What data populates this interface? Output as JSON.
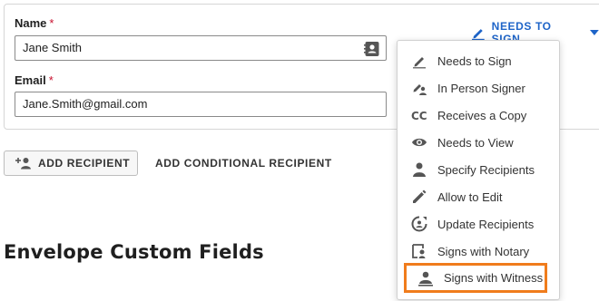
{
  "recipient": {
    "name_label": "Name",
    "name_required": "*",
    "name_value": "Jane Smith",
    "email_label": "Email",
    "email_required": "*",
    "email_value": "Jane.Smith@gmail.com",
    "role_trigger_label": "NEEDS TO SIGN"
  },
  "actions": {
    "add_recipient": "ADD RECIPIENT",
    "add_conditional_recipient": "ADD CONDITIONAL RECIPIENT"
  },
  "section": {
    "title": "Envelope Custom Fields"
  },
  "role_menu": {
    "items": [
      {
        "label": "Needs to Sign",
        "icon": "pen-icon"
      },
      {
        "label": "In Person Signer",
        "icon": "person-pen-icon"
      },
      {
        "label": "Receives a Copy",
        "icon": "cc-icon"
      },
      {
        "label": "Needs to View",
        "icon": "eye-icon"
      },
      {
        "label": "Specify Recipients",
        "icon": "person-icon"
      },
      {
        "label": "Allow to Edit",
        "icon": "pencil-icon"
      },
      {
        "label": "Update Recipients",
        "icon": "person-refresh-icon"
      },
      {
        "label": "Signs with Notary",
        "icon": "notary-icon"
      },
      {
        "label": "Signs with Witness",
        "icon": "witness-icon"
      }
    ],
    "highlighted_item": "Signs with Witness",
    "highlight_color": "#f07c1c"
  },
  "colors": {
    "accent": "#1e64c8",
    "required": "#c8102e"
  }
}
